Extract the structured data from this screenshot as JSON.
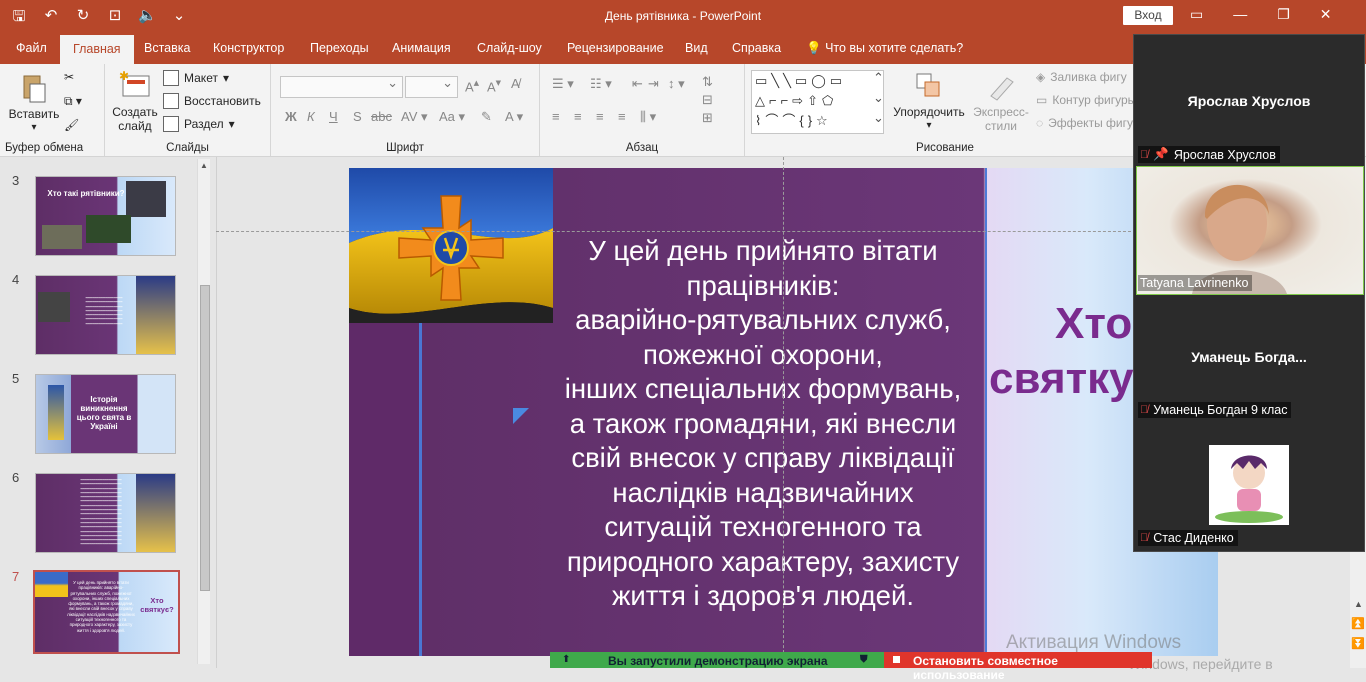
{
  "window": {
    "title": "День рятівника  -  PowerPoint",
    "login_label": "Вход",
    "qa_icons": [
      "save-icon",
      "undo-icon",
      "redo-icon",
      "start-slideshow-icon",
      "speaker-icon",
      "customize-icon"
    ]
  },
  "tabs": [
    "Файл",
    "Главная",
    "Вставка",
    "Конструктор",
    "Переходы",
    "Анимация",
    "Слайд-шоу",
    "Рецензирование",
    "Вид",
    "Справка",
    "Что вы хотите сделать?"
  ],
  "active_tab": "Главная",
  "ribbon": {
    "clipboard": {
      "paste": "Вставить",
      "label": "Буфер обмена"
    },
    "slides": {
      "new_slide_1": "Создать",
      "new_slide_2": "слайд",
      "layout": "Макет",
      "reset": "Восстановить",
      "section": "Раздел",
      "label": "Слайды"
    },
    "font": {
      "label": "Шрифт"
    },
    "paragraph": {
      "label": "Абзац"
    },
    "drawing": {
      "arrange": "Упорядочить",
      "quick_styles_1": "Экспресс-",
      "quick_styles_2": "стили",
      "fill": "Заливка фигу",
      "outline": "Контур фигуры",
      "effects": "Эффекты фигу",
      "label": "Рисование"
    }
  },
  "thumbnails": [
    {
      "num": "3",
      "title": "Хто такі рятівники?"
    },
    {
      "num": "4",
      "title": ""
    },
    {
      "num": "5",
      "title": "Історія виникнення цього свята в Україні"
    },
    {
      "num": "6",
      "title": ""
    },
    {
      "num": "7",
      "title": "Хто святкує?"
    }
  ],
  "thumb7_text": "У цей день прийнято вітати працівників: аварійно-рятувальних служб, пожежної охорони, інших спеціальних формувань, а також громадяни, які внесли свій внесок у справу ліквідації наслідків надзвичайних ситуацій техногенного та природного характеру, захисту життя і здоров'я людей.",
  "slide": {
    "lines": [
      "У цей день прийнято вітати",
      "працівників:",
      "аварійно-рятувальних служб,",
      "пожежної охорони,",
      "інших спеціальних формувань,",
      "а також громадяни, які внесли",
      "свій внесок у справу ліквідації",
      "наслідків надзвичайних",
      "ситуацій техногенного та",
      "природного характеру, захисту",
      "життя і здоров'я людей."
    ],
    "title_1": "Хто",
    "title_2": "святку"
  },
  "watermark": {
    "line1": "Активация Windows",
    "line2": "Windows, перейдите в"
  },
  "participants": [
    {
      "tile_name": "Ярослав Хруслов",
      "label": "Ярослав Хруслов"
    },
    {
      "tile_name": "",
      "label": "Tatyana Lavrinenko"
    },
    {
      "tile_name": "Уманець  Богда...",
      "label": "Уманець Богдан 9 клас"
    },
    {
      "tile_name": "",
      "label": "Стас Диденко"
    }
  ],
  "share": {
    "started": "Вы запустили демонстрацию экрана",
    "stop": "Остановить совместное использование"
  },
  "colors": {
    "accent": "#b7472a",
    "slide_bg": "#6b3778",
    "title_purple": "#7a2b8e",
    "share_green": "#3fa94b",
    "share_red": "#e0352b"
  }
}
